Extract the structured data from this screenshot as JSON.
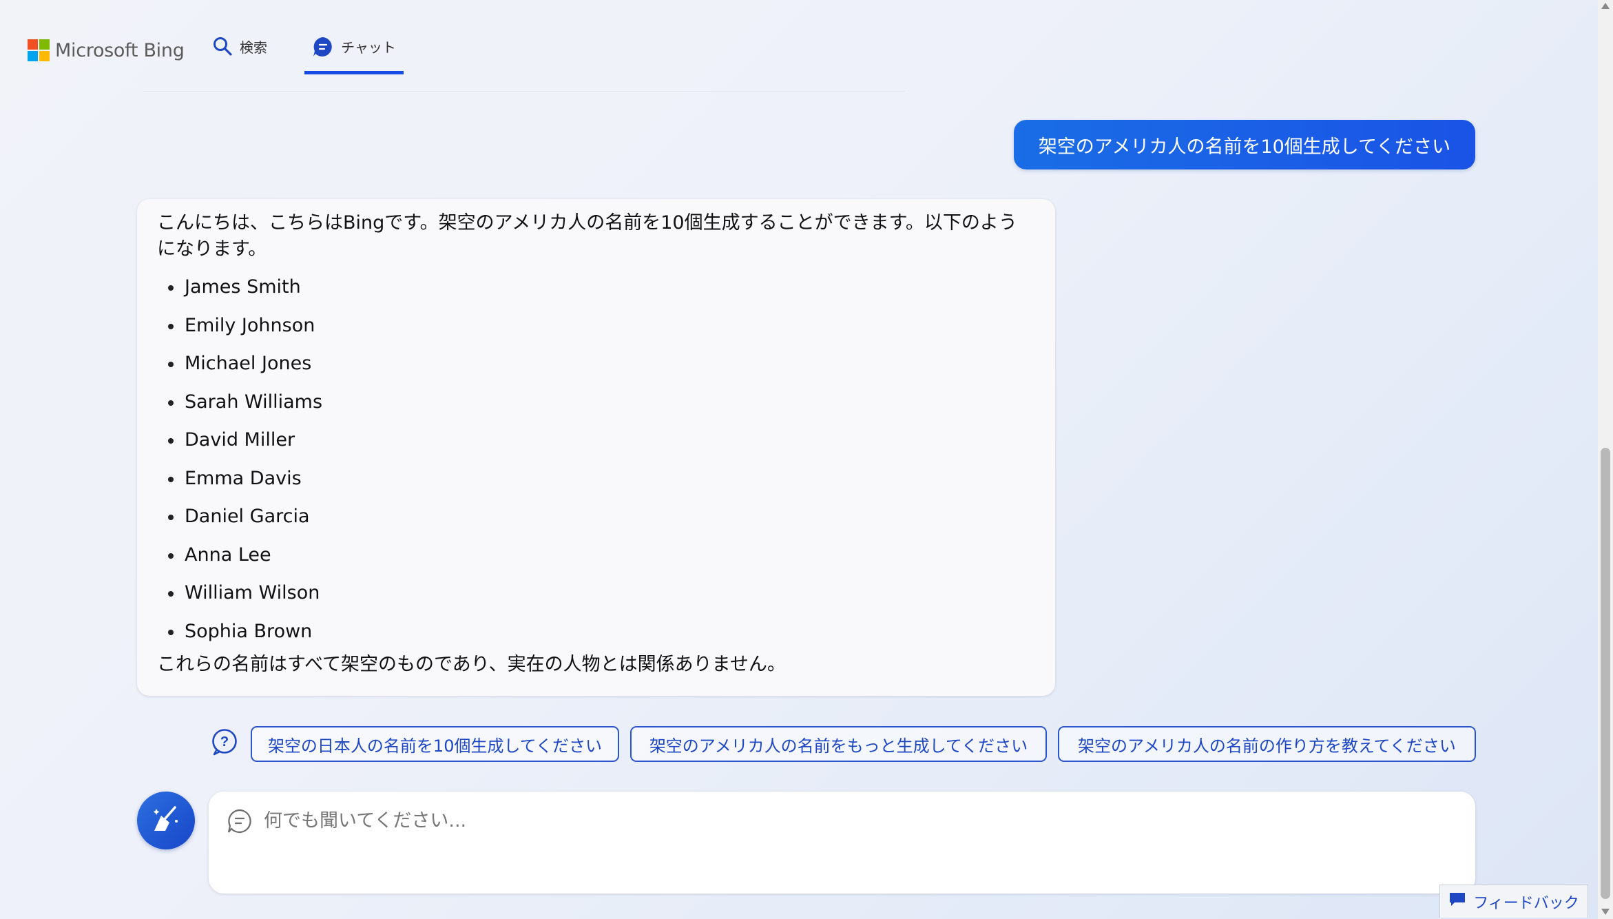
{
  "header": {
    "brand": "Microsoft Bing",
    "tabs": [
      {
        "label": "検索",
        "icon": "search-icon",
        "active": false
      },
      {
        "label": "チャット",
        "icon": "chat-icon",
        "active": true
      }
    ]
  },
  "conversation": {
    "user_message": "架空のアメリカ人の名前を10個生成してください",
    "bot_intro": "こんにちは、こちらはBingです。架空のアメリカ人の名前を10個生成することができます。以下のようになります。",
    "bot_list": [
      "James Smith",
      "Emily Johnson",
      "Michael Jones",
      "Sarah Williams",
      "David Miller",
      "Emma Davis",
      "Daniel Garcia",
      "Anna Lee",
      "William Wilson",
      "Sophia Brown"
    ],
    "bot_outro": "これらの名前はすべて架空のものであり、実在の人物とは関係ありません。"
  },
  "suggestions": [
    "架空の日本人の名前を10個生成してください",
    "架空のアメリカ人の名前をもっと生成してください",
    "架空のアメリカ人の名前の作り方を教えてください"
  ],
  "input": {
    "placeholder": "何でも聞いてください..."
  },
  "feedback": {
    "label": "フィードバック"
  },
  "colors": {
    "accent": "#174ae4",
    "user_bubble": "#1a5ee6",
    "chip_border": "#2a55cf"
  }
}
